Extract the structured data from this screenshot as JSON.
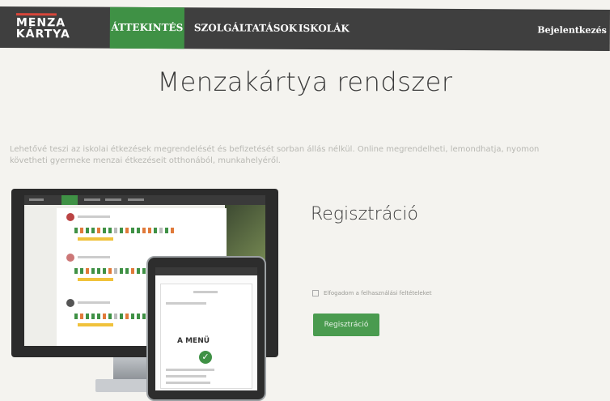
{
  "nav": {
    "logo_line1": "MENZA",
    "logo_line2": "KÁRTYA",
    "items": [
      "ÁTTEKINTÉS",
      "SZOLGÁLTATÁSOK",
      "ISKOLÁK"
    ],
    "active_index": 0,
    "login": "Bejelentkezés"
  },
  "page": {
    "title": "Menzakártya rendszer",
    "intro": "Lehetővé teszi az iskolai étkezések megrendelését és befizetését sorban állás nélkül. Online megrendelheti, lemondhatja, nyomon követheti gyermeke menzai étkezéseit otthonából, munkahelyéről."
  },
  "registration": {
    "title": "Regisztráció",
    "terms_label": "Elfogadom a felhasználási feltételeket",
    "button_label": "Regisztráció"
  },
  "device_preview": {
    "tablet_label": "A MENÜ"
  },
  "colors": {
    "nav_bg": "#3f3f3f",
    "accent_green": "#3f9145",
    "logo_red": "#d8463a"
  }
}
